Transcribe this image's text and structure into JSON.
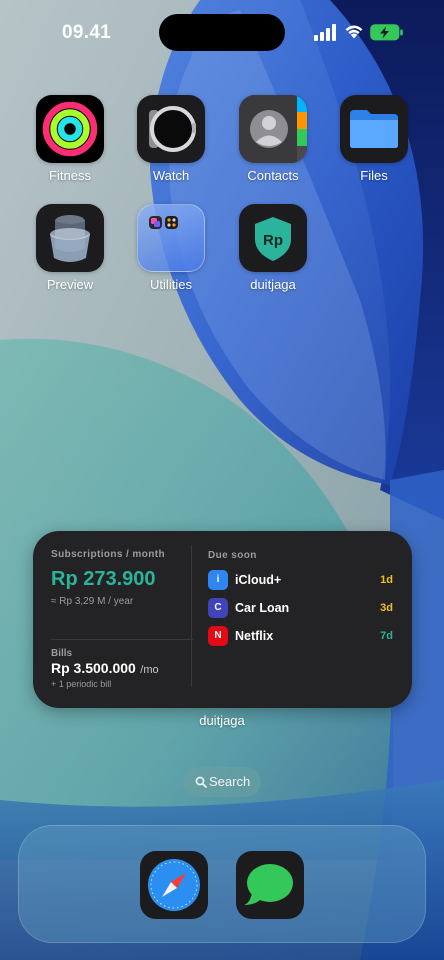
{
  "status_bar": {
    "time": "09.41",
    "icons": [
      "signal-icon",
      "wifi-icon",
      "battery-charging-icon"
    ]
  },
  "apps": [
    {
      "label": "Fitness",
      "icon": "fitness-rings-icon"
    },
    {
      "label": "Watch",
      "icon": "watch-icon"
    },
    {
      "label": "Contacts",
      "icon": "contacts-icon"
    },
    {
      "label": "Files",
      "icon": "folder-icon"
    },
    {
      "label": "Preview",
      "icon": "preview-icon"
    },
    {
      "label": "Utilities",
      "icon": "folder-group-icon"
    },
    {
      "label": "duitjaga",
      "icon": "shield-rp-icon",
      "logo_text": "Rp"
    }
  ],
  "widget": {
    "subscriptions_heading": "Subscriptions / month",
    "subscriptions_amount": "Rp 273.900",
    "subscriptions_yearly": "≈ Rp 3,29 M / year",
    "bills_heading": "Bills",
    "bills_amount": "Rp 3.500.000",
    "bills_unit": "/mo",
    "bills_note": "+ 1 periodic bill",
    "due_heading": "Due soon",
    "due_items": [
      {
        "badge": "i",
        "name": "iCloud+",
        "days": "1d",
        "badge_color": "#2f86f0",
        "days_color": "#f0c020"
      },
      {
        "badge": "C",
        "name": "Car Loan",
        "days": "3d",
        "badge_color": "#3f44b8",
        "days_color": "#f0c020"
      },
      {
        "badge": "N",
        "name": "Netflix",
        "days": "7d",
        "badge_color": "#e50914",
        "days_color": "#2bb39b"
      }
    ],
    "label": "duitjaga"
  },
  "search": {
    "label": "Search"
  },
  "dock": {
    "apps": [
      {
        "name": "safari",
        "icon": "safari-compass-icon"
      },
      {
        "name": "messages",
        "icon": "messages-bubble-icon"
      }
    ]
  },
  "colors": {
    "accent": "#2bb39b",
    "warning": "#f0c020",
    "widget_bg": "#232325"
  }
}
